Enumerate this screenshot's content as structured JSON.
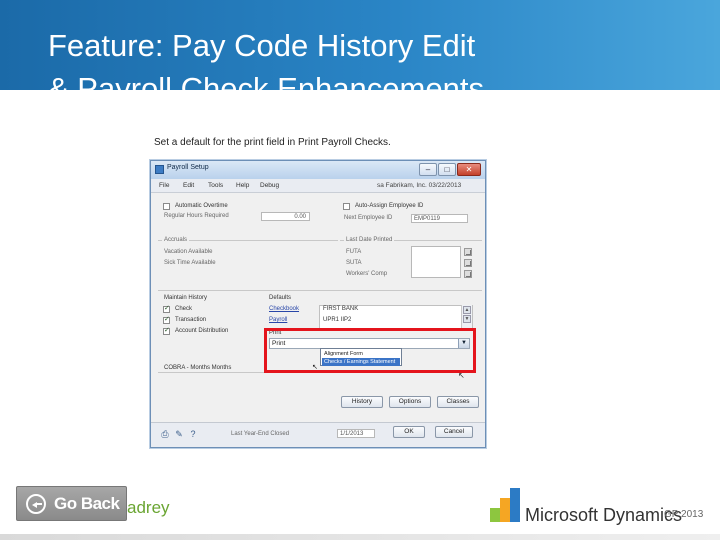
{
  "slide": {
    "title": "Feature: Pay Code History Edit\n& Payroll Check Enhancements",
    "caption": "Set a default for the print field in Print Payroll Checks."
  },
  "window": {
    "title": "Payroll Setup",
    "controls": {
      "minimize": "–",
      "maximize": "□",
      "close": "✕"
    },
    "menus": [
      "File",
      "Edit",
      "Tools",
      "Help",
      "Debug"
    ],
    "company": "sa  Fabrikam, Inc.  03/22/2013",
    "left": {
      "automatic_overtime": "Automatic Overtime",
      "regular_hours_required": "Regular Hours Required",
      "regular_hours_value": "0.00",
      "accruals": "Accruals",
      "vacation_available": "Vacation Available",
      "sick_time_available": "Sick Time Available"
    },
    "right": {
      "auto_assign_employee_id": "Auto-Assign Employee ID",
      "next_employee_id_label": "Next Employee ID",
      "next_employee_id_value": "EMP0119",
      "last_date_printed": "Last Date Printed",
      "futa": "FUTA",
      "suta": "SUTA",
      "workers_comp": "Workers' Comp"
    },
    "history": {
      "maintain_history": "Maintain History",
      "items": [
        "Check",
        "Transaction",
        "Account Distribution"
      ],
      "defaults_label": "Defaults",
      "default_links": [
        "Checkbook",
        "Payroll"
      ],
      "default_values": [
        "FIRST BANK",
        "UPR1 IIP2"
      ],
      "print_label": "Print"
    },
    "print_dropdown": {
      "value": "Print",
      "options": [
        "Alignment Form",
        "Checks / Earnings Statement"
      ]
    },
    "cobra_label": "COBRA - Months Months",
    "buttons": {
      "history": "History",
      "options": "Options",
      "classes": "Classes",
      "ok": "OK",
      "cancel": "Cancel"
    },
    "status": {
      "last_year_end_label": "Last Year-End Closed",
      "date": "1/1/2013"
    }
  },
  "footer": {
    "go_back": "Go Back",
    "brand_fragment": "adrey",
    "ms_product": "Microsoft Dynamics",
    "ms_version": "GP 2013"
  },
  "colors": {
    "header_blue": "#1b6aa8",
    "highlight_red": "#e4141c",
    "brand_green": "#6aa532"
  }
}
